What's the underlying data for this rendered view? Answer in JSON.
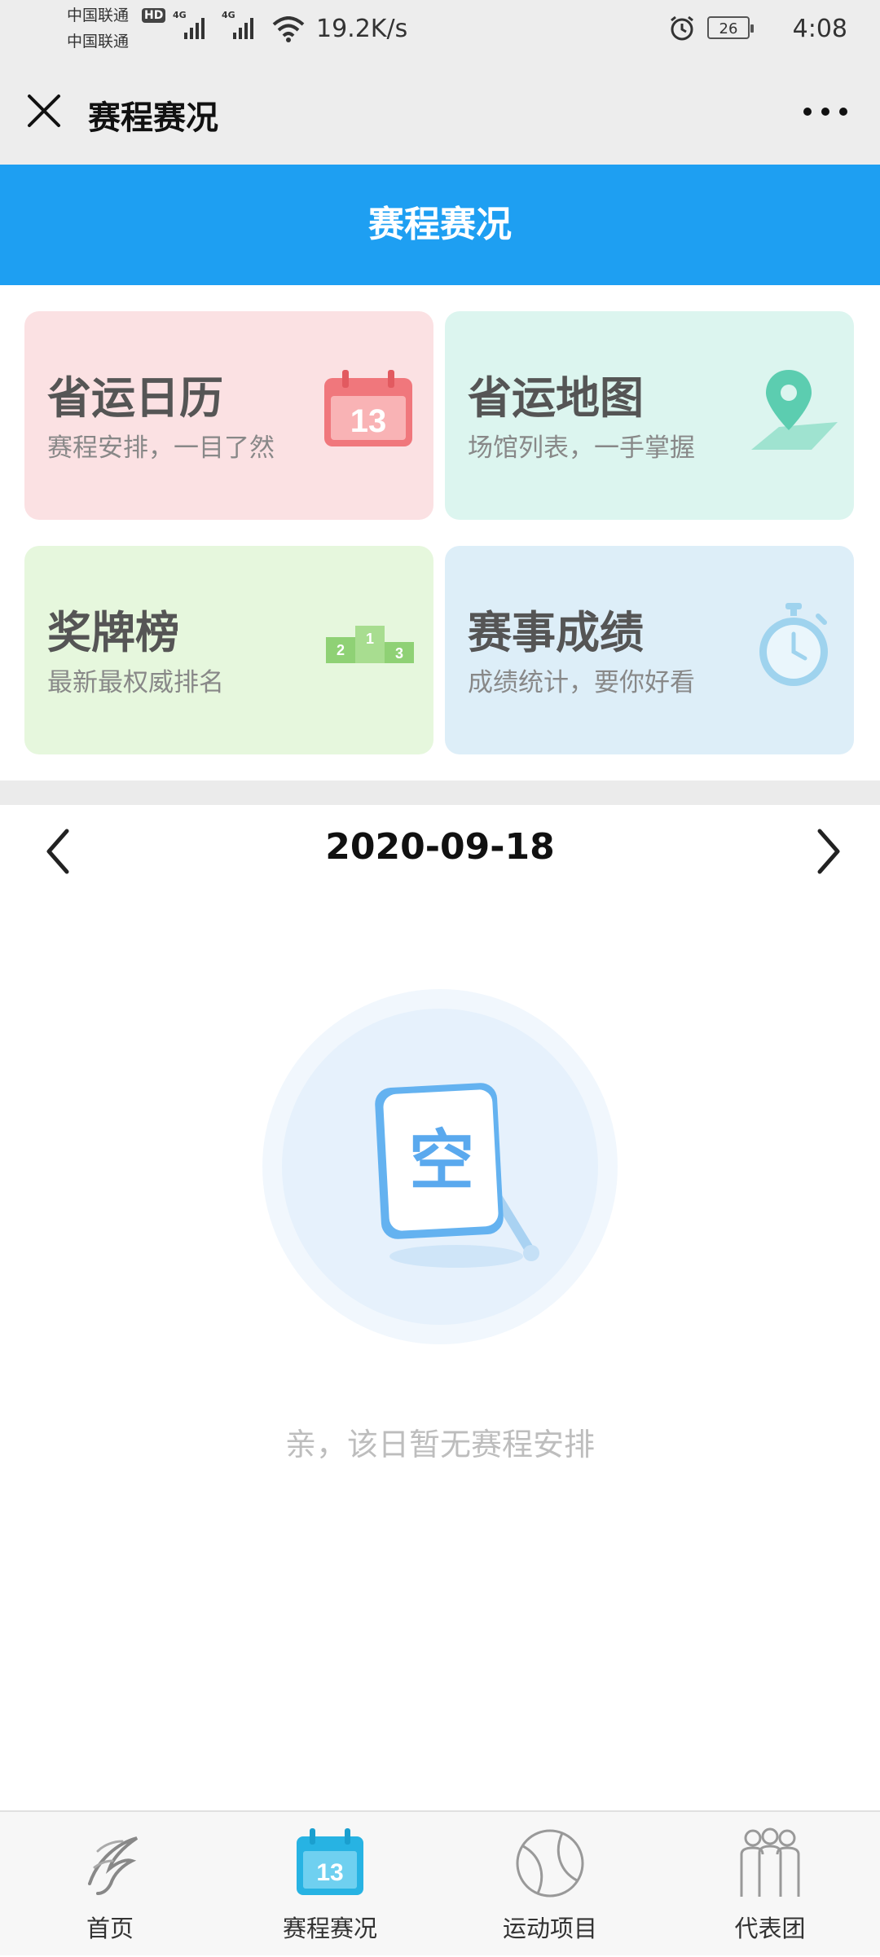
{
  "status_bar": {
    "carrier_1": "中国联通",
    "carrier_2": "中国联通",
    "hd": "HD",
    "network_1": "4G",
    "network_2": "4G",
    "speed": "19.2K/s",
    "battery": "26",
    "time": "4:08"
  },
  "header": {
    "title": "赛程赛况"
  },
  "banner": {
    "title": "赛程赛况"
  },
  "cards": [
    {
      "title": "省运日历",
      "subtitle": "赛程安排，一目了然",
      "icon": "calendar-icon",
      "icon_text": "13",
      "color": "#fbe1e3"
    },
    {
      "title": "省运地图",
      "subtitle": "场馆列表，一手掌握",
      "icon": "map-pin-icon",
      "color": "#dcf5ef"
    },
    {
      "title": "奖牌榜",
      "subtitle": "最新最权威排名",
      "icon": "podium-icon",
      "icon_labels": [
        "2",
        "1",
        "3"
      ],
      "color": "#e6f7dd"
    },
    {
      "title": "赛事成绩",
      "subtitle": "成绩统计，要你好看",
      "icon": "stopwatch-icon",
      "color": "#ddeef8"
    }
  ],
  "date_nav": {
    "date": "2020-09-18"
  },
  "empty_state": {
    "illustration_text": "空",
    "message": "亲，该日暂无赛程安排"
  },
  "tab_bar": {
    "items": [
      {
        "label": "首页",
        "icon": "logo-icon"
      },
      {
        "label": "赛程赛况",
        "icon": "calendar-icon",
        "icon_text": "13",
        "active": true
      },
      {
        "label": "运动项目",
        "icon": "ball-icon"
      },
      {
        "label": "代表团",
        "icon": "team-icon"
      }
    ]
  },
  "colors": {
    "accent": "#1e9ff2",
    "calendar_red": "#f0777c",
    "map_green": "#5ccdb0",
    "medal_green": "#8fd175",
    "watch_blue": "#9fd3ee"
  }
}
